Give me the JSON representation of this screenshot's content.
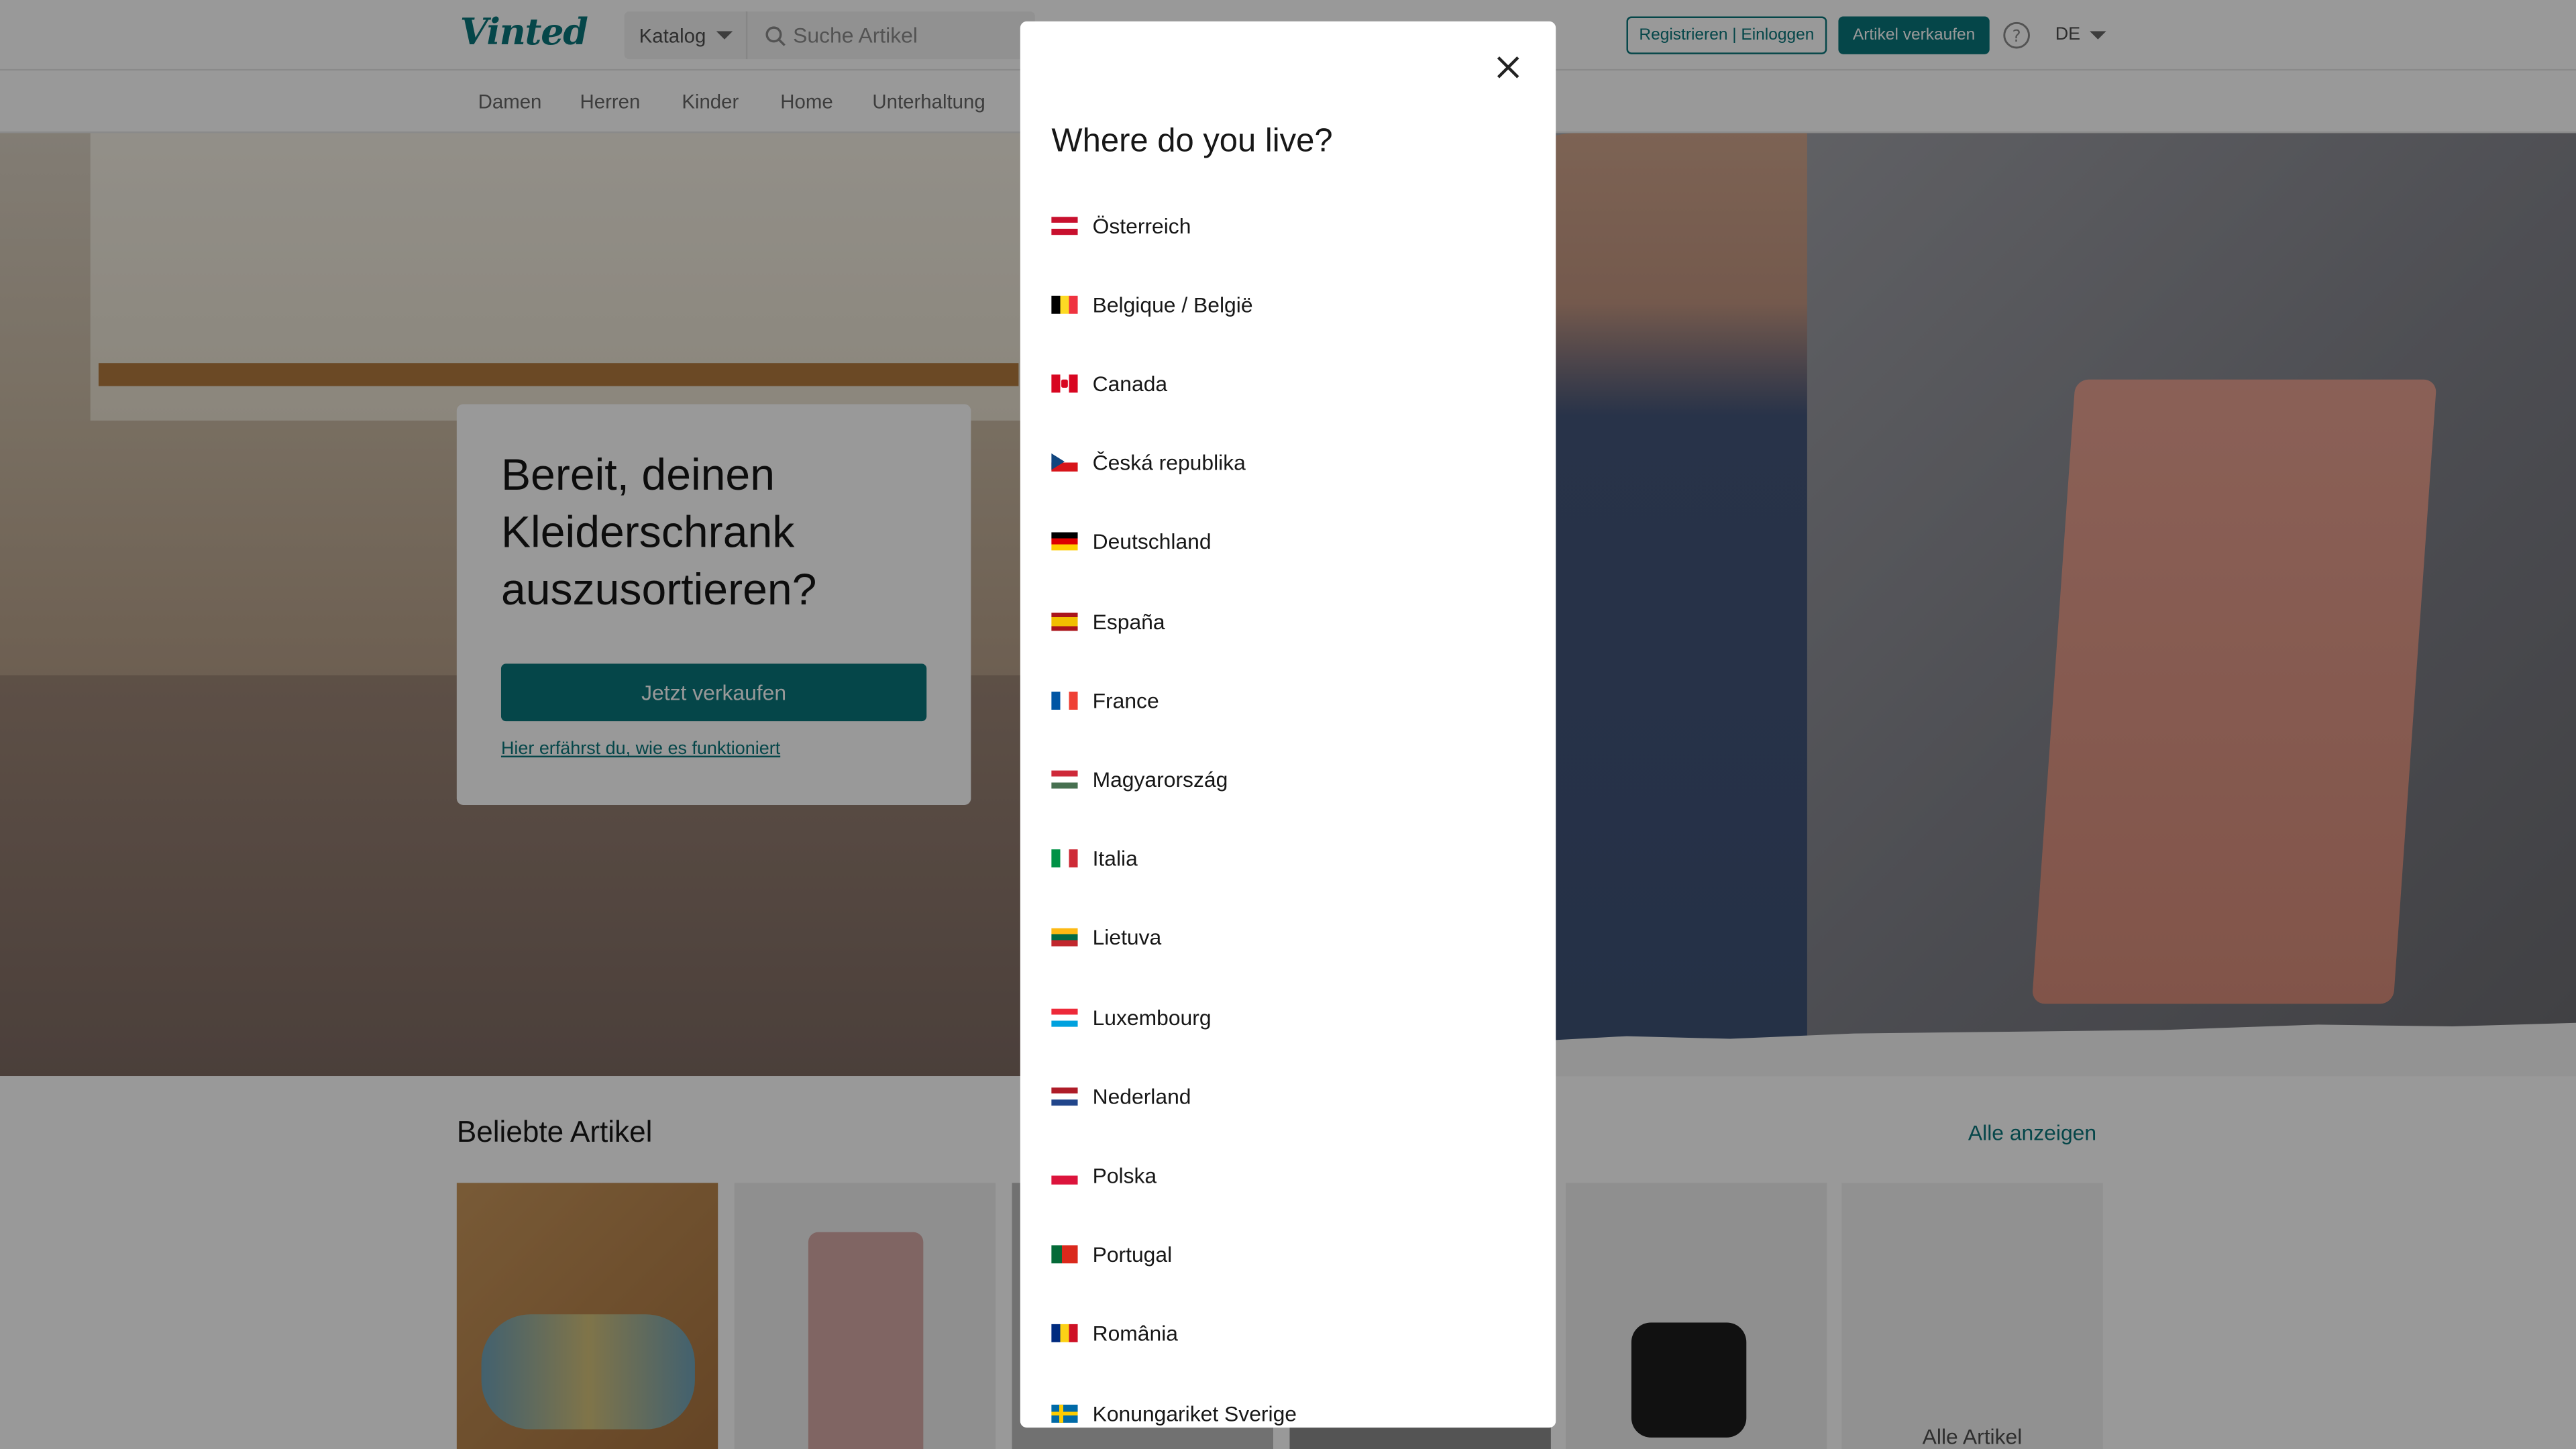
{
  "header": {
    "logo": "Vinted",
    "catalog_label": "Katalog",
    "search_placeholder": "Suche Artikel",
    "register_login": "Registrieren | Einloggen",
    "sell_button": "Artikel verkaufen",
    "language": "DE"
  },
  "subnav": [
    "Damen",
    "Herren",
    "Kinder",
    "Home",
    "Unterhaltung"
  ],
  "hero": {
    "title": "Bereit, deinen Kleiderschrank auszusortieren?",
    "cta": "Jetzt verkaufen",
    "link": "Hier erfährst du, wie es funktioniert"
  },
  "popular": {
    "title": "Beliebte Artikel",
    "see_all": "Alle anzeigen",
    "last_tile": "Alle Artikel"
  },
  "modal": {
    "title": "Where do you live?",
    "countries": [
      {
        "name": "Österreich",
        "flag": [
          "#c8102e",
          "#ffffff",
          "#c8102e"
        ],
        "dir": "h"
      },
      {
        "name": "Belgique / België",
        "flag": [
          "#000000",
          "#fdda24",
          "#ef3340"
        ],
        "dir": "v"
      },
      {
        "name": "Canada",
        "flag": [
          "#d80621",
          "#ffffff",
          "#d80621"
        ],
        "dir": "v"
      },
      {
        "name": "Česká republika",
        "flag": [
          "#ffffff",
          "#d7141a",
          "#11457e"
        ],
        "dir": "cz"
      },
      {
        "name": "Deutschland",
        "flag": [
          "#000000",
          "#dd0000",
          "#ffce00"
        ],
        "dir": "h"
      },
      {
        "name": "España",
        "flag": [
          "#aa151b",
          "#f1bf00",
          "#aa151b"
        ],
        "dir": "es"
      },
      {
        "name": "France",
        "flag": [
          "#0055a4",
          "#ffffff",
          "#ef4135"
        ],
        "dir": "v"
      },
      {
        "name": "Magyarország",
        "flag": [
          "#ce2939",
          "#ffffff",
          "#477050"
        ],
        "dir": "h"
      },
      {
        "name": "Italia",
        "flag": [
          "#009246",
          "#ffffff",
          "#ce2b37"
        ],
        "dir": "v"
      },
      {
        "name": "Lietuva",
        "flag": [
          "#fdb913",
          "#006a44",
          "#c1272d"
        ],
        "dir": "h"
      },
      {
        "name": "Luxembourg",
        "flag": [
          "#ed2939",
          "#ffffff",
          "#00a1de"
        ],
        "dir": "h"
      },
      {
        "name": "Nederland",
        "flag": [
          "#ae1c28",
          "#ffffff",
          "#21468b"
        ],
        "dir": "h"
      },
      {
        "name": "Polska",
        "flag": [
          "#ffffff",
          "#dc143c",
          "#dc143c"
        ],
        "dir": "pl"
      },
      {
        "name": "Portugal",
        "flag": [
          "#046a38",
          "#da291c",
          "#da291c"
        ],
        "dir": "pt"
      },
      {
        "name": "România",
        "flag": [
          "#002b7f",
          "#fcd116",
          "#ce1126"
        ],
        "dir": "v"
      },
      {
        "name": "Konungariket Sverige",
        "flag": [
          "#006aa7",
          "#fecc00",
          "#006aa7"
        ],
        "dir": "se"
      }
    ]
  },
  "colors": {
    "brand": "#09757a"
  }
}
